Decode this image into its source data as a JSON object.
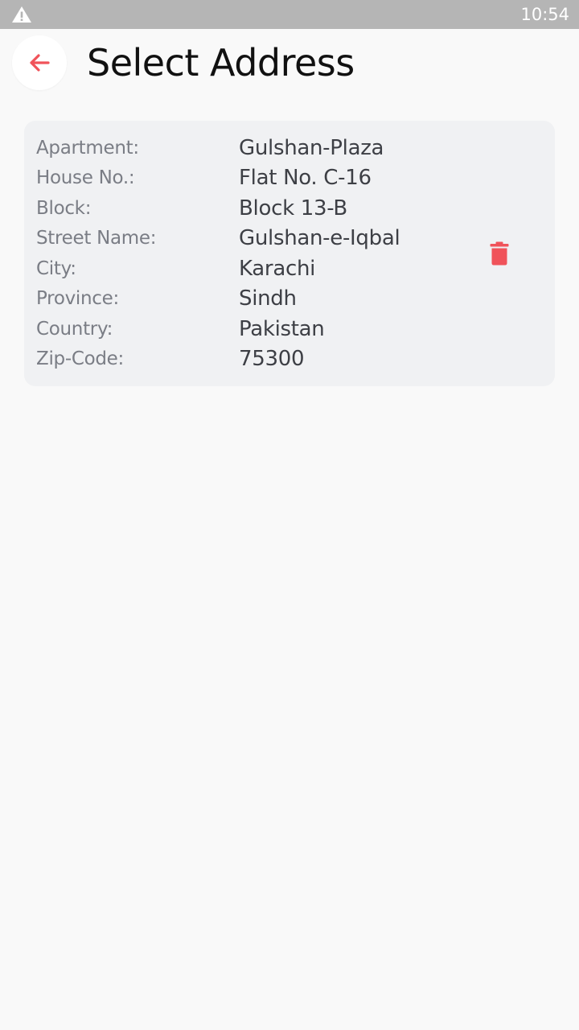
{
  "status_bar": {
    "time": "10:54",
    "warning_icon": "warning-triangle-icon"
  },
  "header": {
    "back_icon": "arrow-left-icon",
    "title": "Select Address"
  },
  "address_card": {
    "delete_icon": "trash-icon",
    "fields": [
      {
        "label": "Apartment:",
        "value": "Gulshan-Plaza"
      },
      {
        "label": "House No.:",
        "value": "Flat No. C-16"
      },
      {
        "label": "Block:",
        "value": "Block 13-B"
      },
      {
        "label": "Street Name:",
        "value": "Gulshan-e-Iqbal"
      },
      {
        "label": "City:",
        "value": "Karachi"
      },
      {
        "label": "Province:",
        "value": "Sindh"
      },
      {
        "label": "Country:",
        "value": "Pakistan"
      },
      {
        "label": "Zip-Code:",
        "value": "75300"
      }
    ]
  },
  "colors": {
    "accent": "#f0535a",
    "status_bar": "#b5b5b5",
    "card_background": "#f0f1f3",
    "page_background": "#f9f9f9"
  }
}
